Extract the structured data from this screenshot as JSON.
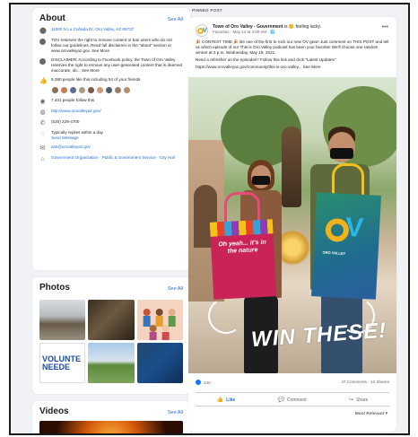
{
  "about": {
    "title": "About",
    "see_all": "See All",
    "address": "11000 N La Cañada Dr, Oro Valley, AZ 85737",
    "disclaimer_short": "TOV reserves the right to remove content or ban users who do not follow our guidelines. Read full disclaimer in the \"about\" section or www.orovalleyaz.gov. See More",
    "disclaimer_long": "DISCLAIMER: According to Facebook policy, the Town of Oro Valley reserves the right to remove any user-generated content that is deemed inaccurate, ob... See More",
    "likes_text": "9,390 people like this including 54 of your friends",
    "follows_text": "7,431 people follow this",
    "website": "http://www.orovalleyaz.gov/",
    "phone": "(520) 229-4700",
    "response": "Typically replies within a day",
    "send_message": "Send Message",
    "email": "ask@orovalleyaz.gov",
    "category": "Government Organization · Public & Government Service · City Hall"
  },
  "photos": {
    "title": "Photos",
    "see_all": "See All",
    "volunteer_line1": "VOLUNTE",
    "volunteer_line2": "NEEDE"
  },
  "videos": {
    "title": "Videos",
    "see_all": "See All"
  },
  "post": {
    "pinned_label": "PINNED POST",
    "page_name": "Town of Oro Valley - Government",
    "feeling": "is 😊 feeling lucky.",
    "meta": "Favorites · May 14 at 4:00 AM · 🌐",
    "body_1": "🎉 CONTEST TIME 🎉 Be one of the first to rock our new OV gear! Just comment on THIS POST and tell us which episode of our This is Oro Valley podcast has been your favorite! We'll choose one random winner at 3 p.m. Wednesday, May 19, 2021.",
    "body_2": "Need a refresher on the episodes? Follow this link and click \"Latest Updates\"",
    "body_3": "https://www.orovalleyaz.gov/community/this-is-oro-valley... See More",
    "bag_text": "Oh yeah... it's in the nature",
    "bag_sub": "ORO VALLEY",
    "win_text": "WIN THESE!",
    "reaction_count": "140",
    "comments_shares": "37 Comments · 10 Shares",
    "like_label": "Like",
    "comment_label": "Comment",
    "share_label": "Share",
    "most_relevant": "Most Relevant ▾"
  },
  "icons": {
    "address": "pin-icon",
    "info": "info-icon",
    "likes": "thumbs-up-icon",
    "follows": "rss-icon",
    "website": "globe-icon",
    "phone": "phone-icon",
    "messenger": "messenger-icon",
    "email": "mail-icon",
    "category": "tag-icon"
  },
  "colors": {
    "link": "#216fdb",
    "background": "#f0f2f5",
    "card": "#ffffff"
  }
}
